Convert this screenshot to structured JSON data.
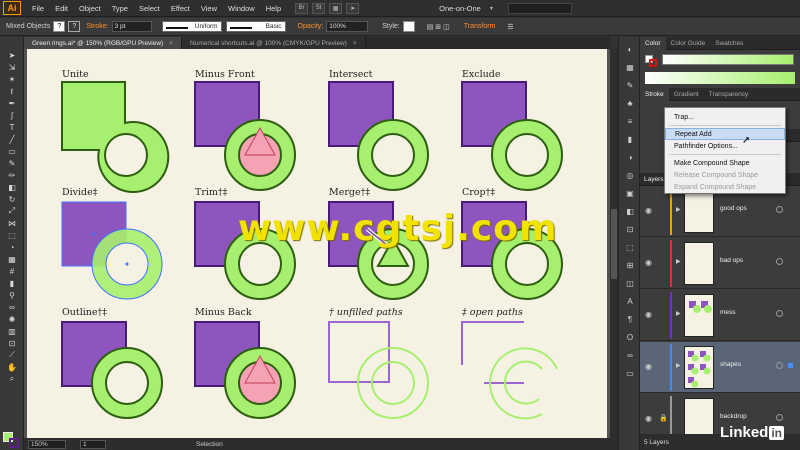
{
  "app": {
    "logo": "Ai",
    "menu": [
      "File",
      "Edit",
      "Object",
      "Type",
      "Select",
      "Effect",
      "View",
      "Window",
      "Help"
    ],
    "mini_buttons": [
      "Br",
      "St"
    ],
    "workspace": "One-on-One"
  },
  "control_bar": {
    "selection_label": "Mixed Objects",
    "stroke_label": "Stroke:",
    "stroke_weight": "3 pt",
    "profile": "Uniform",
    "brush": "Basic",
    "opacity_label": "Opacity:",
    "opacity_value": "100%",
    "style_label": "Style:",
    "transform_label": "Transform",
    "fill_color": "#a7ef6e",
    "stroke_color": "#5e1e8c"
  },
  "tabs": [
    {
      "label": "Green rings.ai* @ 150% (RGB/GPU Preview)",
      "active": true
    },
    {
      "label": "Numerical shortcuts.ai @ 100% (CMYK/GPU Preview)",
      "active": false
    }
  ],
  "artboard": {
    "labels": {
      "unite": "Unite",
      "minus_front": "Minus Front",
      "intersect": "Intersect",
      "exclude": "Exclude",
      "divide": "Divide‡",
      "trim": "Trim†‡",
      "merge": "Merge†‡",
      "crop": "Crop†‡",
      "outline": "Outline†‡",
      "minus_back": "Minus Back",
      "unfilled": "† unfilled paths",
      "open": "‡ open paths"
    },
    "colors": {
      "green": "#a7ef6e",
      "dark_green": "#2e5e12",
      "purple": "#8e55bf",
      "dark_purple": "#4a1a7a",
      "pink": "#f4a2b4",
      "paper": "#f5f1e3"
    }
  },
  "status_bar": {
    "zoom": "150%",
    "page": "1",
    "tool": "Selection"
  },
  "panels": {
    "color_tabs": [
      "Color",
      "Color Guide",
      "Swatches"
    ],
    "stroke_tabs": [
      "Stroke",
      "Gradient",
      "Transparency"
    ],
    "layers_title": "Layers",
    "layers": [
      {
        "name": "good ops",
        "color": "#f2a000"
      },
      {
        "name": "bad ops",
        "color": "#e03030"
      },
      {
        "name": "mess",
        "color": "#7a2ad0"
      },
      {
        "name": "shapes",
        "color": "#3c8cff",
        "selected": true
      },
      {
        "name": "backdrop",
        "color": "#9a9a9a",
        "locked": true
      }
    ],
    "layers_count": "5 Layers"
  },
  "flyout": {
    "items": [
      {
        "label": "Trap...",
        "disabled": false
      },
      {
        "label": "Repeat Add",
        "disabled": false,
        "hover": true
      },
      {
        "label": "Pathfinder Options...",
        "disabled": false
      },
      {
        "label": "Make Compound Shape",
        "disabled": false
      },
      {
        "label": "Release Compound Shape",
        "disabled": true
      },
      {
        "label": "Expand Compound Shape",
        "disabled": true
      }
    ]
  },
  "watermark": "www.cgtsj.com",
  "brand": {
    "text": "Linked",
    "suffix": "in"
  }
}
